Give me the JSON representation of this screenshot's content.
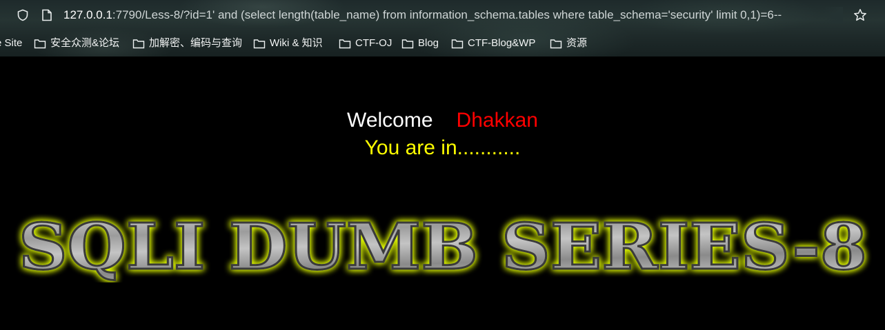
{
  "browser": {
    "url_host": "127.0.0.1",
    "url_rest": ":7790/Less-8/?id=1' and (select length(table_name) from information_schema.tables where table_schema='security' limit 0,1)=6--",
    "icons": [
      "shield-icon",
      "page-icon",
      "star-icon",
      "folder-icon"
    ]
  },
  "bookmarks": [
    {
      "label": "e Site",
      "folder": false
    },
    {
      "label": "安全众测&论坛",
      "folder": true
    },
    {
      "label": "加解密、编码与查询",
      "folder": true
    },
    {
      "label": "Wiki & 知识",
      "folder": true
    },
    {
      "label": "CTF-OJ",
      "folder": true
    },
    {
      "label": "Blog",
      "folder": true
    },
    {
      "label": "CTF-Blog&WP",
      "folder": true
    },
    {
      "label": "资源",
      "folder": true
    }
  ],
  "page": {
    "welcome": "Welcome",
    "user": "Dhakkan",
    "status": "You are in...........",
    "banner_text": "SQLI DUMB SERIES-8"
  },
  "colors": {
    "background": "#000000",
    "welcome": "#ffffff",
    "user": "#ff0000",
    "status": "#ffff00",
    "banner_fill": "#a9a9a9",
    "banner_glow": "#e6ff00"
  }
}
